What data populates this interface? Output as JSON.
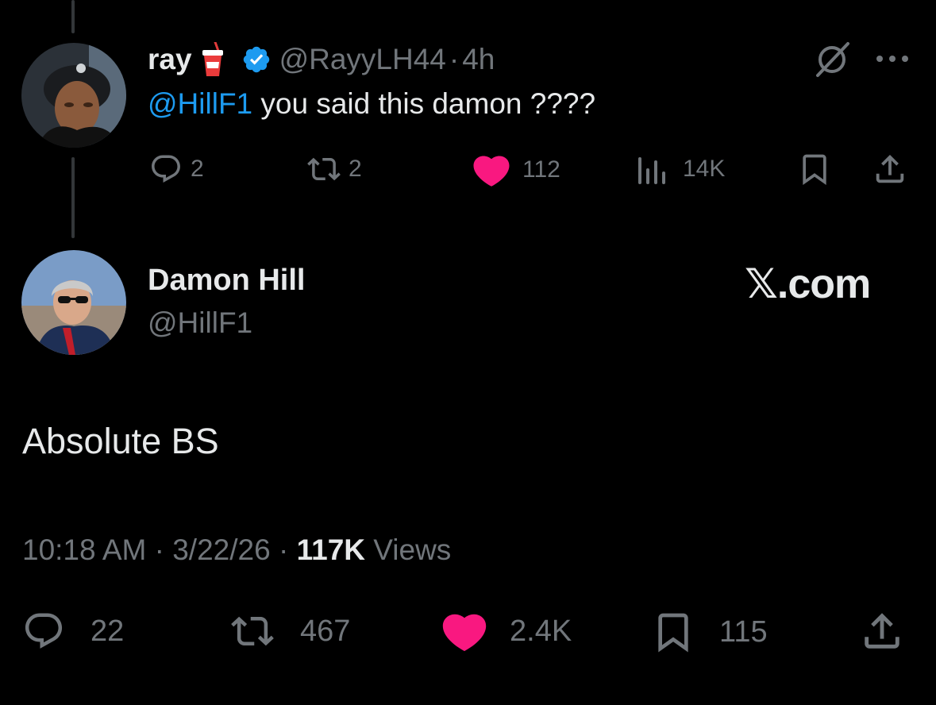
{
  "reply_tweet": {
    "author_name": "ray",
    "author_handle": "@RayyLH44",
    "separator": "·",
    "time_ago": "4h",
    "mention": "@HillF1",
    "text": " you said this damon ????",
    "stats": {
      "replies": "2",
      "reposts": "2",
      "likes": "112",
      "views": "14K"
    },
    "icons": [
      "drink-cup-emoji",
      "verified-badge-icon",
      "grok-icon",
      "more-icon",
      "reply-icon",
      "repost-icon",
      "heart-icon",
      "views-icon",
      "bookmark-icon",
      "share-icon"
    ]
  },
  "main_tweet": {
    "author_name": "Damon Hill",
    "author_handle": "@HillF1",
    "watermark": "𝕏.com",
    "text": "Absolute BS",
    "time": "10:18 AM",
    "sep1": " · ",
    "date": "3/22/26",
    "sep2": " · ",
    "views_count": "117K",
    "views_label": " Views",
    "stats": {
      "replies": "22",
      "reposts": "467",
      "likes": "2.4K",
      "bookmarks": "115"
    }
  },
  "colors": {
    "background": "#000000",
    "text": "#e7e9ea",
    "secondary": "#71767b",
    "link": "#1d9bf0",
    "like": "#f91880",
    "verified": "#1d9bf0"
  }
}
